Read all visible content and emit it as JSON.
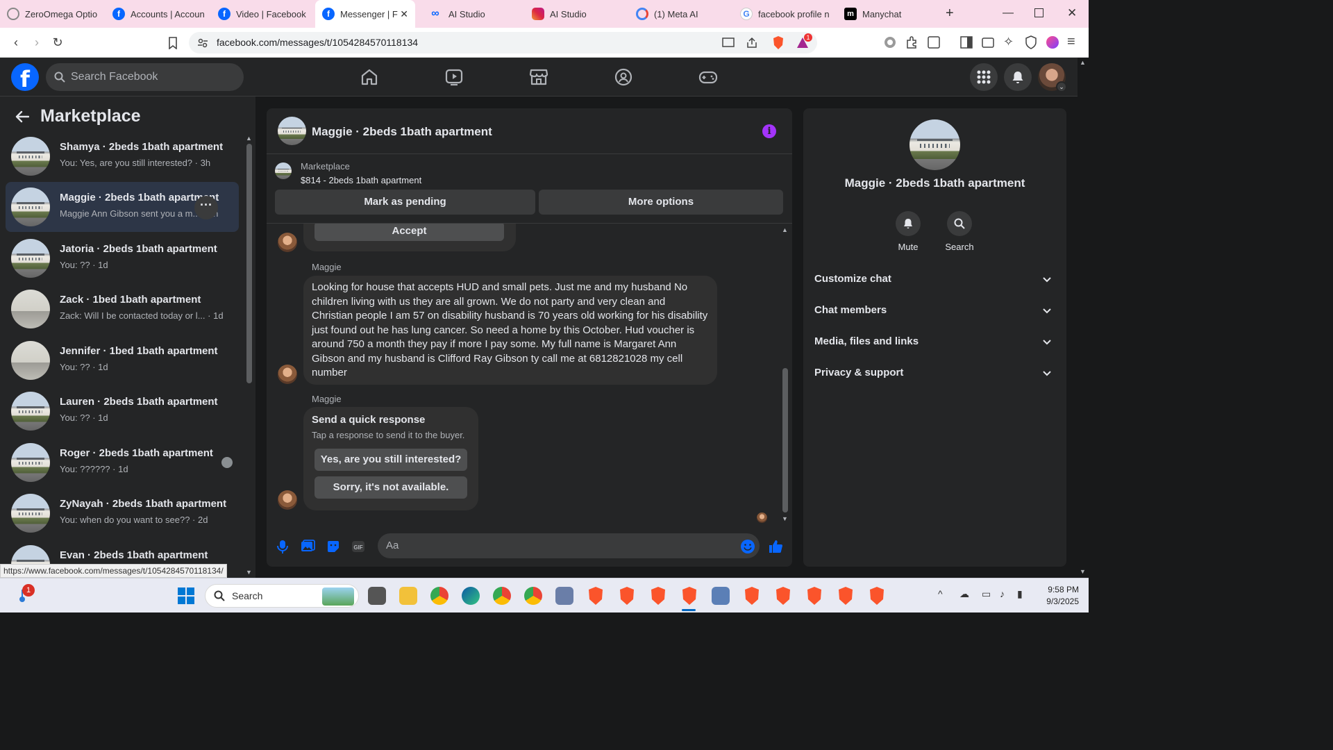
{
  "browser": {
    "tabs": [
      {
        "title": "ZeroOmega Optio",
        "icon": "zeroomega-icon",
        "color": "#888888"
      },
      {
        "title": "Accounts | Accoun",
        "icon": "facebook-icon",
        "color": "#0866ff"
      },
      {
        "title": "Video | Facebook",
        "icon": "facebook-icon",
        "color": "#0866ff"
      },
      {
        "title": "Messenger | F",
        "icon": "facebook-icon",
        "color": "#0866ff"
      },
      {
        "title": "AI Studio",
        "icon": "meta-icon",
        "color": "#0866ff"
      },
      {
        "title": "AI Studio",
        "icon": "instagram-icon",
        "color": "#e1306c"
      },
      {
        "title": "(1) Meta AI",
        "icon": "meta-ai-icon",
        "color": "#4285f4"
      },
      {
        "title": "facebook profile n",
        "icon": "google-icon",
        "color": "#4285f4"
      },
      {
        "title": "Manychat",
        "icon": "manychat-icon",
        "color": "#000000"
      }
    ],
    "url": "facebook.com/messages/t/1054284570118134",
    "status_url": "https://www.facebook.com/messages/t/1054284570118134/",
    "new_tab": "+",
    "brave_badge": "1"
  },
  "fb": {
    "logo": "f",
    "search_placeholder": "Search Facebook",
    "accent": "#0866ff"
  },
  "sidebar": {
    "title": "Marketplace",
    "conversations": [
      {
        "name": "Shamya · 2beds 1bath apartment",
        "preview": "You: Yes, are you still interested? · 3h",
        "thumb": "house"
      },
      {
        "name": "Maggie · 2beds 1bath apartment",
        "preview": "Maggie Ann Gibson sent you a m... · 3h",
        "thumb": "house",
        "active": true
      },
      {
        "name": "Jatoria · 2beds 1bath apartment",
        "preview": "You: ?? · 1d",
        "thumb": "house"
      },
      {
        "name": "Zack · 1bed 1bath apartment",
        "preview": "Zack: Will I be contacted today or l... · 1d",
        "thumb": "room"
      },
      {
        "name": "Jennifer · 1bed 1bath apartment",
        "preview": "You: ?? · 1d",
        "thumb": "room"
      },
      {
        "name": "Lauren · 2beds 1bath apartment",
        "preview": "You: ?? · 1d",
        "thumb": "house"
      },
      {
        "name": "Roger · 2beds 1bath apartment",
        "preview": "You: ?????? · 1d",
        "thumb": "house"
      },
      {
        "name": "ZyNayah · 2beds 1bath apartment",
        "preview": "You: when do you want to see?? · 2d",
        "thumb": "house"
      },
      {
        "name": "Evan · 2beds 1bath apartment",
        "preview": "",
        "thumb": "house"
      }
    ]
  },
  "chat": {
    "title": "Maggie · 2beds 1bath apartment",
    "marketplace_label": "Marketplace",
    "listing": "$814 - 2beds 1bath apartment",
    "mark_pending": "Mark as pending",
    "more_options": "More options",
    "accept": "Accept",
    "sender1": "Maggie",
    "message": "Looking for house that accepts HUD and small pets. Just me and my husband No children living with us they are all grown. We do not party and very clean and Christian people I am 57 on disability husband is 70 years old working for his disability just found out he has lung cancer. So need a home by this October.  Hud voucher is around 750 a month they pay if more I pay some. My full name is Margaret Ann Gibson and my husband is Clifford Ray Gibson ty call me at 6812821028 my cell number",
    "sender2": "Maggie",
    "quick_title": "Send a quick response",
    "quick_sub": "Tap a response to send it to the buyer.",
    "quick_1": "Yes, are you still interested?",
    "quick_2": "Sorry, it's not available.",
    "composer_placeholder": "Aa"
  },
  "details": {
    "name": "Maggie · 2beds 1bath apartment",
    "mute": "Mute",
    "search": "Search",
    "sections": [
      "Customize chat",
      "Chat members",
      "Media, files and links",
      "Privacy & support"
    ]
  },
  "taskbar": {
    "search": "Search",
    "time": "9:58 PM",
    "date": "9/3/2025",
    "notif_badge": "1"
  }
}
